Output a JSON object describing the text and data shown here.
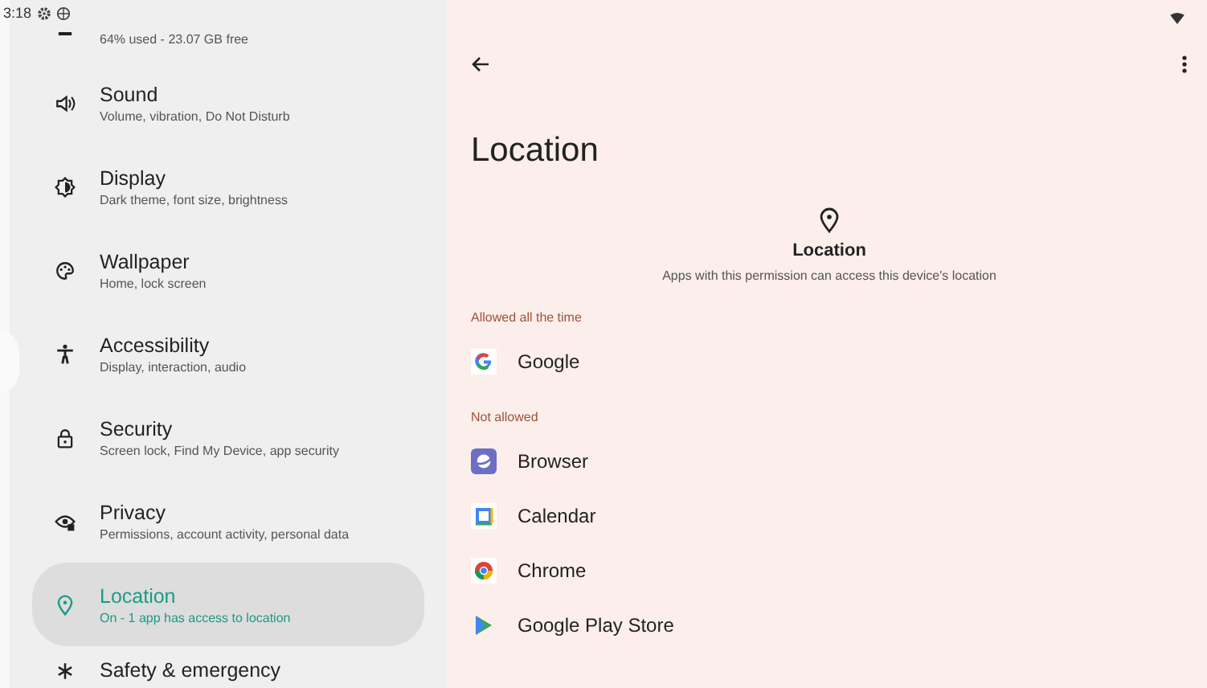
{
  "status_bar": {
    "time": "3:18"
  },
  "sidebar": {
    "items": [
      {
        "subtitle": "64% used - 23.07 GB free",
        "selected": false
      },
      {
        "title": "Sound",
        "subtitle": "Volume, vibration, Do Not Disturb",
        "selected": false
      },
      {
        "title": "Display",
        "subtitle": "Dark theme, font size, brightness",
        "selected": false
      },
      {
        "title": "Wallpaper",
        "subtitle": "Home, lock screen",
        "selected": false
      },
      {
        "title": "Accessibility",
        "subtitle": "Display, interaction, audio",
        "selected": false
      },
      {
        "title": "Security",
        "subtitle": "Screen lock, Find My Device, app security",
        "selected": false
      },
      {
        "title": "Privacy",
        "subtitle": "Permissions, account activity, personal data",
        "selected": false
      },
      {
        "title": "Location",
        "subtitle": "On - 1 app has access to location",
        "selected": true
      },
      {
        "title": "Safety & emergency",
        "selected": false
      }
    ]
  },
  "page": {
    "title": "Location",
    "header": {
      "title": "Location",
      "description": "Apps with this permission can access this device's location"
    },
    "sections": [
      {
        "heading": "Allowed all the time",
        "apps": [
          {
            "name": "Google"
          }
        ]
      },
      {
        "heading": "Not allowed",
        "apps": [
          {
            "name": "Browser"
          },
          {
            "name": "Calendar"
          },
          {
            "name": "Chrome"
          },
          {
            "name": "Google Play Store"
          }
        ]
      }
    ]
  }
}
